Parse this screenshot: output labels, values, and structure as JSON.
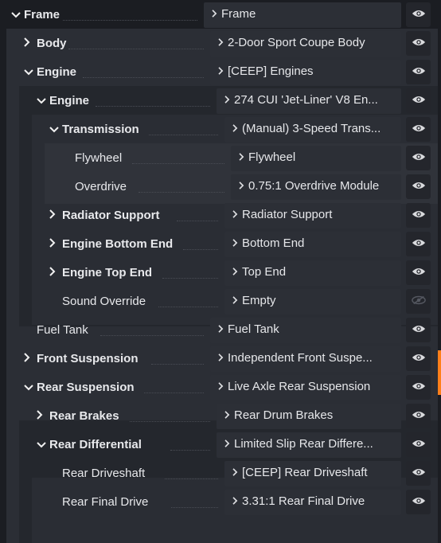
{
  "tree": [
    {
      "label": "Frame",
      "level": 0,
      "bold": true,
      "expander": "down",
      "value": "Frame"
    },
    {
      "label": "Body",
      "level": 1,
      "bold": true,
      "expander": "right",
      "value": "2-Door Sport Coupe Body"
    },
    {
      "label": "Engine",
      "level": 1,
      "bold": true,
      "expander": "down",
      "value": "[CEEP] Engines"
    },
    {
      "label": "Engine",
      "level": 2,
      "bold": true,
      "expander": "down",
      "value": "274 CUI 'Jet-Liner' V8 En..."
    },
    {
      "label": "Transmission",
      "level": 3,
      "bold": true,
      "expander": "down",
      "value": "(Manual) 3-Speed Trans..."
    },
    {
      "label": "Flywheel",
      "level": 4,
      "bold": false,
      "expander": "none",
      "value": "Flywheel"
    },
    {
      "label": "Overdrive",
      "level": 4,
      "bold": false,
      "expander": "none",
      "value": "0.75:1 Overdrive Module"
    },
    {
      "label": "Radiator Support",
      "level": 3,
      "bold": true,
      "expander": "right",
      "value": "Radiator Support"
    },
    {
      "label": "Engine Bottom End",
      "level": 3,
      "bold": true,
      "expander": "right",
      "value": "Bottom End"
    },
    {
      "label": "Engine Top End",
      "level": 3,
      "bold": true,
      "expander": "right",
      "value": "Top End"
    },
    {
      "label": "Sound Override",
      "level": 3,
      "bold": false,
      "expander": "none",
      "value": "Empty",
      "eye": "disabled"
    },
    {
      "label": "Fuel Tank",
      "level": 1,
      "bold": false,
      "expander": "none",
      "value": "Fuel Tank"
    },
    {
      "label": "Front Suspension",
      "level": 1,
      "bold": true,
      "expander": "right",
      "value": "Independent Front Suspe..."
    },
    {
      "label": "Rear Suspension",
      "level": 1,
      "bold": true,
      "expander": "down",
      "value": "Live Axle Rear Suspension"
    },
    {
      "label": "Rear Brakes",
      "level": 2,
      "bold": true,
      "expander": "right",
      "value": "Rear Drum Brakes"
    },
    {
      "label": "Rear Differential",
      "level": 2,
      "bold": true,
      "expander": "down",
      "value": "Limited Slip Rear Differe..."
    },
    {
      "label": "Rear Driveshaft",
      "level": 3,
      "bold": false,
      "expander": "none",
      "value": "[CEEP] Rear Driveshaft"
    },
    {
      "label": "Rear Final Drive",
      "level": 3,
      "bold": false,
      "expander": "none",
      "value": "3.31:1 Rear Final Drive"
    }
  ],
  "icons": {
    "expand_down": "chevron-down-icon",
    "expand_right": "chevron-right-icon",
    "dropdown": "caret-right-icon",
    "visibility": "eye-icon"
  },
  "colors": {
    "background": "#1b1d22",
    "dropdown_bg": "#2c2f36",
    "eye_bg": "#24262c",
    "accent": "#ff7f1a"
  }
}
